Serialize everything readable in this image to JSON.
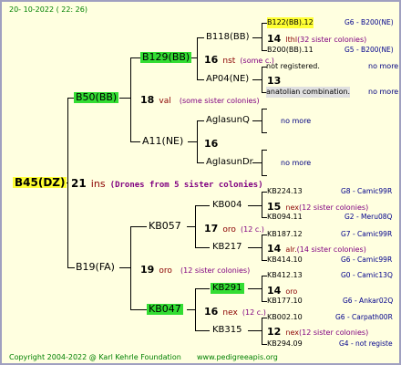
{
  "date": "20- 10-2022 ( 22: 26)",
  "footer": "Copyright 2004-2022 @ Karl Kehrle Foundation",
  "url": "www.pedigreeapis.org",
  "root": {
    "name": "B45(DZ)",
    "num": "21",
    "colony": "ins",
    "drones": "(Drones from 5 sister colonies)"
  },
  "l1_top": {
    "name": "B50(BB)",
    "num": "18",
    "colony": "val",
    "sisters": "(some sister colonies)"
  },
  "l1_bot": {
    "name": "B19(FA)",
    "num": "19",
    "colony": "oro",
    "sisters": "(12 sister colonies)"
  },
  "l2_a": {
    "name": "B129(BB)",
    "num": "16",
    "colony": "nst",
    "sisters": "(some c.)"
  },
  "l2_b": {
    "name": "A11(NE)",
    "num": "16"
  },
  "l2_c": {
    "name": "KB057",
    "num": "17",
    "colony": "oro",
    "sisters": "(12 c.)"
  },
  "l2_d": {
    "name": "KB047",
    "num": "16",
    "colony": "nex",
    "sisters": "(12 c.)"
  },
  "l3": [
    {
      "name": "B118(BB)",
      "num": "14",
      "colony": "lthl",
      "sisters": "(32 sister colonies)"
    },
    {
      "name": "AP04(NE)",
      "num": "13"
    },
    {
      "name": "AglasunQ"
    },
    {
      "name": "AglasunDr"
    },
    {
      "name": "KB004",
      "num": "15",
      "colony": "nex",
      "sisters": "(12 sister colonies)"
    },
    {
      "name": "KB217",
      "num": "14",
      "colony": "alr.",
      "sisters": "(14 sister colonies)"
    },
    {
      "name": "KB291",
      "num": "14",
      "colony": "oro"
    },
    {
      "name": "KB315",
      "num": "12",
      "colony": "nex",
      "sisters": "(12 sister colonies)"
    }
  ],
  "leaves": [
    {
      "name": "B122(BB).12",
      "place": "G6 - B200(NE)"
    },
    {
      "name": "B200(BB).11",
      "place": "G5 - B200(NE)"
    },
    {
      "name": "not registered.",
      "place": "no more"
    },
    {
      "name": "anatolian combination.",
      "place": "no more"
    },
    {
      "name": "",
      "place": "no more"
    },
    {
      "name": "",
      "place": "no more"
    },
    {
      "name": "KB224.13",
      "place": "G8 - Camic99R"
    },
    {
      "name": "KB094.11",
      "place": "G2 - Meru08Q"
    },
    {
      "name": "KB187.12",
      "place": "G7 - Camic99R"
    },
    {
      "name": "KB414.10",
      "place": "G6 - Camic99R"
    },
    {
      "name": "KB412.13",
      "place": "G0 - Camic13Q"
    },
    {
      "name": "KB177.10",
      "place": "G6 - Ankar02Q"
    },
    {
      "name": "KB002.10",
      "place": "G6 - Carpath00R"
    },
    {
      "name": "KB294.09",
      "place": "G4 - not registe"
    }
  ]
}
